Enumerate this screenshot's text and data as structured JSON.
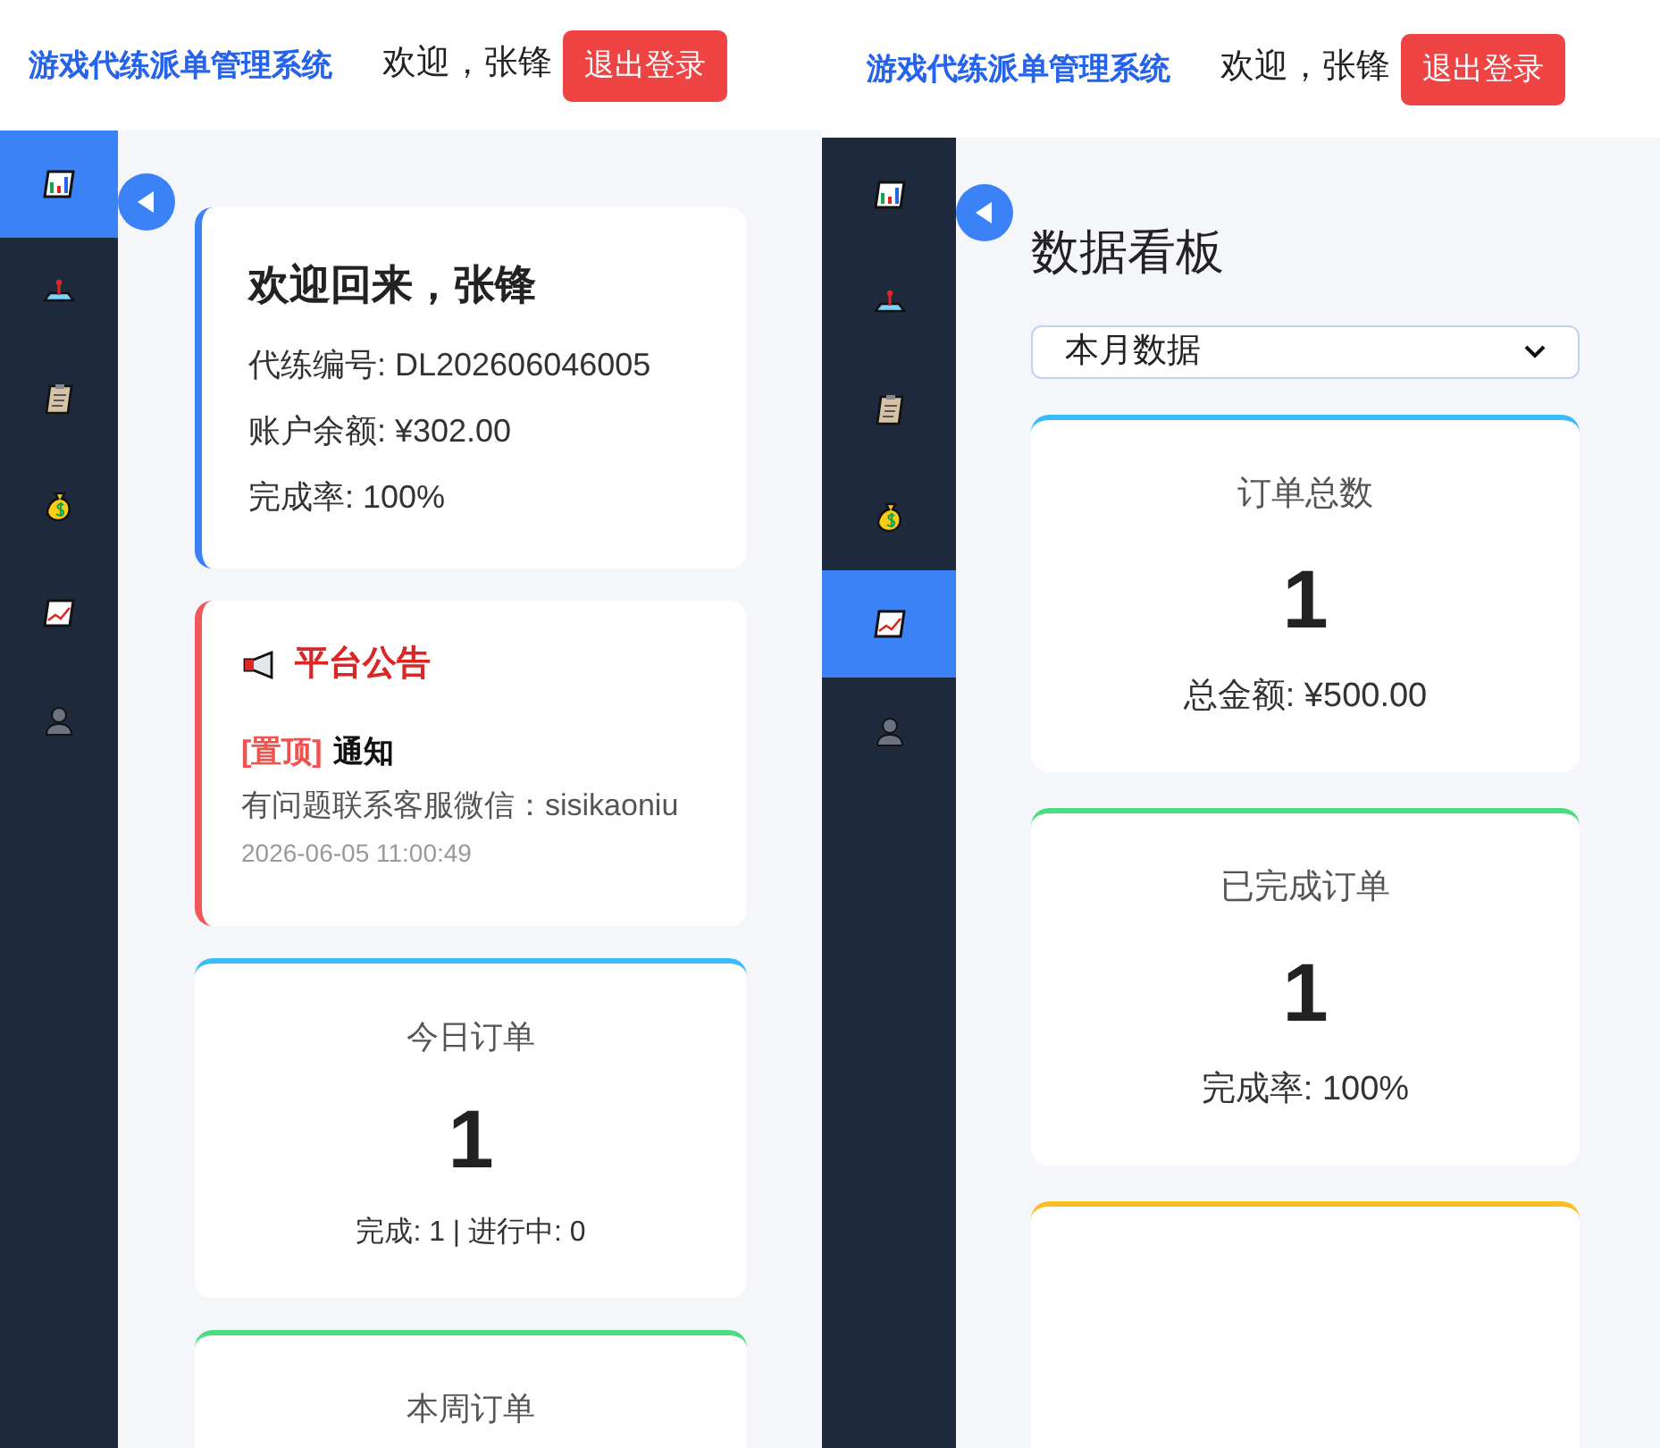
{
  "screens": [
    {
      "header": {
        "title": "游戏代练派单管理系统",
        "greeting": "欢迎，张锋",
        "logout": "退出登录"
      },
      "sidebar": [
        {
          "selected": true
        },
        {
          "selected": false
        },
        {
          "selected": false
        },
        {
          "selected": false
        },
        {
          "selected": false
        },
        {
          "selected": false
        }
      ],
      "content": [
        {
          "kind": "welcome",
          "title": "欢迎回来，张锋",
          "lines": [
            "代练编号: DL202606046005",
            "账户余额: ¥302.00",
            "完成率: 100%"
          ]
        },
        {
          "kind": "notice",
          "title": "平台公告",
          "tag": "[置顶]",
          "subject": "通知",
          "body": "有问题联系客服微信：sisikaoniu",
          "time": "2026-06-05 11:00:49"
        },
        {
          "kind": "stat",
          "color": "#38bdf8",
          "label": "今日订单",
          "value": "1",
          "detail": "完成: 1 | 进行中: 0"
        },
        {
          "kind": "stat",
          "color": "#4ade80",
          "label": "本周订单"
        }
      ]
    },
    {
      "header": {
        "title": "游戏代练派单管理系统",
        "greeting": "欢迎，张锋",
        "logout": "退出登录"
      },
      "sidebar": [
        {
          "selected": false
        },
        {
          "selected": false
        },
        {
          "selected": false
        },
        {
          "selected": false
        },
        {
          "selected": true
        },
        {
          "selected": false
        }
      ],
      "content": [
        {
          "kind": "heading",
          "text": "数据看板"
        },
        {
          "kind": "select",
          "value": "本月数据"
        },
        {
          "kind": "stat",
          "color": "#38bdf8",
          "label": "订单总数",
          "value": "1",
          "detail": "总金额: ¥500.00"
        },
        {
          "kind": "stat",
          "color": "#4ade80",
          "label": "已完成订单",
          "value": "1",
          "detail": "完成率: 100%"
        },
        {
          "kind": "stat",
          "color": "#fbbf24"
        }
      ]
    }
  ]
}
